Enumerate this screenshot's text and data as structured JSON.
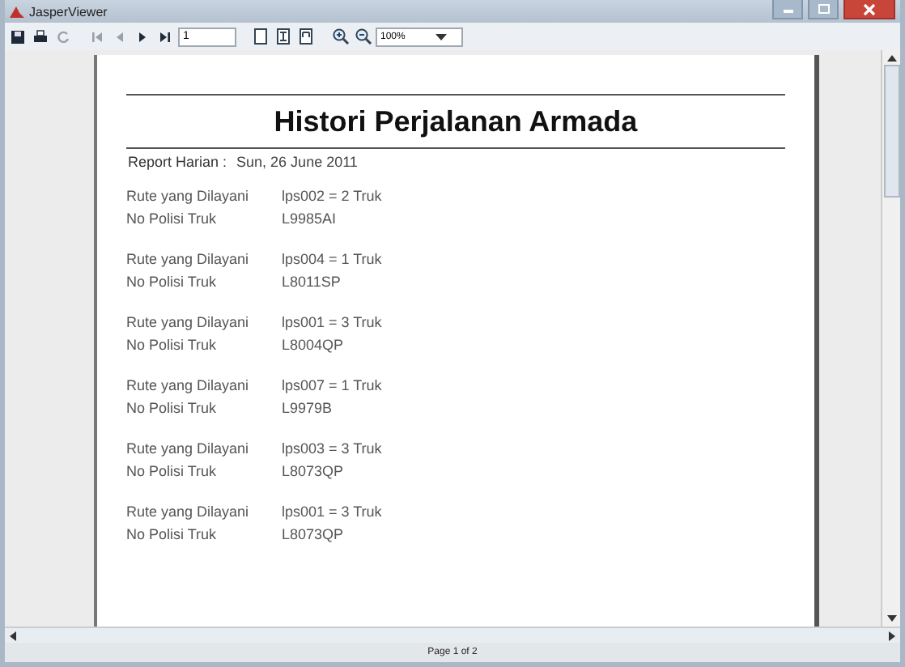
{
  "window": {
    "title": "JasperViewer"
  },
  "toolbar": {
    "buttons": [
      {
        "kind": "save",
        "disabled": false
      },
      {
        "kind": "print",
        "disabled": false
      },
      {
        "kind": "reload",
        "disabled": true
      },
      {
        "kind": "first",
        "disabled": true
      },
      {
        "kind": "prev",
        "disabled": true
      },
      {
        "kind": "next",
        "disabled": false
      },
      {
        "kind": "last",
        "disabled": false
      }
    ],
    "page_field": {
      "value": "1"
    },
    "view_buttons": [
      {
        "kind": "actual"
      },
      {
        "kind": "fit-page"
      },
      {
        "kind": "fit-width"
      }
    ],
    "zoom_buttons": [
      {
        "kind": "zoom-in"
      },
      {
        "kind": "zoom-out"
      }
    ],
    "zoom": {
      "value": "100%"
    }
  },
  "report": {
    "title": "Histori Perjalanan Armada",
    "date_label": "Report Harian :",
    "date": "Sun, 26 June 2011",
    "entries": [
      {
        "route_label": "Rute yang Dilayani",
        "route": "lps002 = 2 Truk",
        "plate_label": "No Polisi Truk",
        "plate": "L9985AI"
      },
      {
        "route_label": "Rute yang Dilayani",
        "route": "lps004 = 1 Truk",
        "plate_label": "No Polisi Truk",
        "plate": "L8011SP"
      },
      {
        "route_label": "Rute yang Dilayani",
        "route": "lps001 = 3 Truk",
        "plate_label": "No Polisi Truk",
        "plate": "L8004QP"
      },
      {
        "route_label": "Rute yang Dilayani",
        "route": "lps007 = 1 Truk",
        "plate_label": "No Polisi Truk",
        "plate": "L9979B"
      },
      {
        "route_label": "Rute yang Dilayani",
        "route": "lps003 = 3 Truk",
        "plate_label": "No Polisi Truk",
        "plate": "L8073QP"
      },
      {
        "route_label": "Rute yang Dilayani",
        "route": "lps001 = 3 Truk",
        "plate_label": "No Polisi Truk",
        "plate": "L8073QP"
      }
    ]
  },
  "status_bar": {
    "text": "Page 1 of 2"
  }
}
